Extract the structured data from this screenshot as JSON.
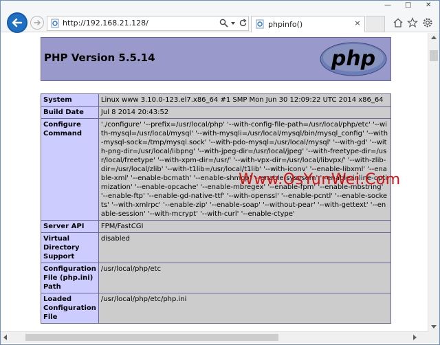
{
  "browser": {
    "address": "http://192.168.21.128/",
    "tab_title": "phpinfo()",
    "tab_close": "×",
    "window_minimize": "—",
    "window_maximize": "□",
    "window_close": "✕"
  },
  "icons": {
    "back": "back-arrow-icon",
    "forward": "forward-arrow-icon",
    "page": "ie-page-icon",
    "search": "search-icon",
    "dropdown": "chevron-down-icon",
    "refresh": "refresh-icon",
    "home": "home-icon",
    "favorites": "star-icon",
    "settings": "gear-icon"
  },
  "colors": {
    "header_bg": "#9999cc",
    "label_bg": "#ccccff",
    "value_bg": "#cccccc",
    "border": "#666699",
    "watermark": "#d31212",
    "back_button": "#1f6fc5"
  },
  "page": {
    "header_title": "PHP Version 5.5.14",
    "logo_text": "php",
    "watermark": "Www.OsYunWei.Com",
    "rows": [
      {
        "label": "System",
        "value": "Linux www 3.10.0-123.el7.x86_64 #1 SMP Mon Jun 30 12:09:22 UTC 2014 x86_64"
      },
      {
        "label": "Build Date",
        "value": "Jul 8 2014 20:43:52"
      },
      {
        "label": "Configure Command",
        "value": "'./configure' '--prefix=/usr/local/php' '--with-config-file-path=/usr/local/php/etc' '--with-mysql=/usr/local/mysql' '--with-mysqli=/usr/local/mysql/bin/mysql_config' '--with-mysql-sock=/tmp/mysql.sock' '--with-pdo-mysql=/usr/local/mysql' '--with-gd' '--with-png-dir=/usr/local/libpng' '--with-jpeg-dir=/usr/local/jpeg' '--with-freetype-dir=/usr/local/freetype' '--with-xpm-dir=/usr/' '--with-vpx-dir=/usr/local/libvpx/' '--with-zlib-dir=/usr/local/zlib' '--with-t1lib=/usr/local/t1lib' '--with-iconv' '--enable-libxml' '--enable-xml' '--enable-bcmath' '--enable-shmop' '--enable-sysvsem' '--enable-inline-optimization' '--enable-opcache' '--enable-mbregex' '--enable-fpm' '--enable-mbstring' '--enable-ftp' '--enable-gd-native-ttf' '--with-openssl' '--enable-pcntl' '--enable-sockets' '--with-xmlrpc' '--enable-zip' '--enable-soap' '--without-pear' '--with-gettext' '--enable-session' '--with-mcrypt' '--with-curl' '--enable-ctype'"
      },
      {
        "label": "Server API",
        "value": "FPM/FastCGI"
      },
      {
        "label": "Virtual Directory Support",
        "value": "disabled"
      },
      {
        "label": "Configuration File (php.ini) Path",
        "value": "/usr/local/php/etc"
      },
      {
        "label": "Loaded Configuration File",
        "value": "/usr/local/php/etc/php.ini"
      }
    ]
  }
}
